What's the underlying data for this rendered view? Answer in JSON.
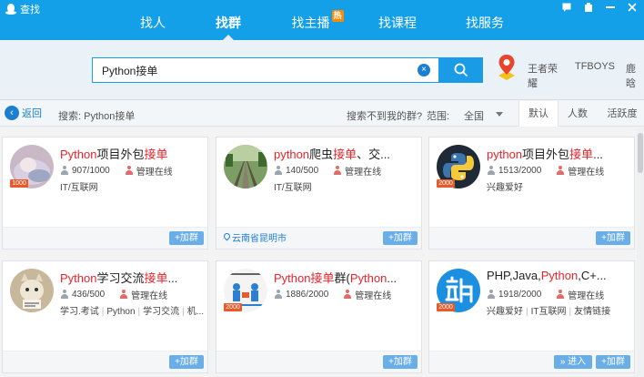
{
  "window": {
    "title": "查找",
    "controls": [
      "message-icon",
      "skin-icon",
      "minimize-icon",
      "close-icon"
    ]
  },
  "nav": {
    "tabs": [
      {
        "label": "找人",
        "active": false
      },
      {
        "label": "找群",
        "active": true
      },
      {
        "label": "找主播",
        "active": false,
        "badge": "热"
      },
      {
        "label": "找课程",
        "active": false
      },
      {
        "label": "找服务",
        "active": false
      }
    ]
  },
  "search": {
    "value": "Python接单",
    "clear_icon": "clear-icon",
    "button_icon": "search-icon",
    "hot_words": [
      "王者荣耀",
      "TFBOYS",
      "鹿晗"
    ]
  },
  "filter": {
    "back_label": "返回",
    "breadcrumb": "搜索: Python接单",
    "not_found": "搜索不到我的群?",
    "range_label": "范围:",
    "range_value": "全国",
    "sort_tabs": [
      {
        "label": "默认",
        "active": true
      },
      {
        "label": "人数",
        "active": false
      },
      {
        "label": "活跃度",
        "active": false
      }
    ]
  },
  "results": [
    {
      "title_parts": [
        {
          "t": "Python",
          "h": true
        },
        {
          "t": "项目外包",
          "h": false
        },
        {
          "t": "接单",
          "h": true
        }
      ],
      "members": "907/1000",
      "admin": "管理在线",
      "tags": [
        "IT/互联网"
      ],
      "badge": "1000",
      "location": "",
      "enter": "",
      "join": "+加群"
    },
    {
      "title_parts": [
        {
          "t": "python",
          "h": true
        },
        {
          "t": "爬虫",
          "h": false
        },
        {
          "t": "接单",
          "h": true
        },
        {
          "t": "、交...",
          "h": false
        }
      ],
      "members": "140/500",
      "admin": "管理在线",
      "tags": [
        "IT/互联网"
      ],
      "badge": "",
      "location": "云南省昆明市",
      "enter": "",
      "join": "+加群"
    },
    {
      "title_parts": [
        {
          "t": "python",
          "h": true
        },
        {
          "t": "项目外包",
          "h": false
        },
        {
          "t": "接单",
          "h": true
        },
        {
          "t": "...",
          "h": false
        }
      ],
      "members": "1513/2000",
      "admin": "管理在线",
      "tags": [
        "兴趣爱好"
      ],
      "badge": "2000",
      "location": "",
      "enter": "",
      "join": "+加群"
    },
    {
      "title_parts": [
        {
          "t": "Python",
          "h": true
        },
        {
          "t": "学习交流",
          "h": false
        },
        {
          "t": "接单",
          "h": true
        },
        {
          "t": "...",
          "h": false
        }
      ],
      "members": "436/500",
      "admin": "管理在线",
      "tags": [
        "学习.考试",
        "Python",
        "学习交流",
        "机..."
      ],
      "badge": "",
      "location": "",
      "enter": "",
      "join": "+加群"
    },
    {
      "title_parts": [
        {
          "t": "Python",
          "h": true
        },
        {
          "t": "接单",
          "h": true
        },
        {
          "t": "群(",
          "h": false
        },
        {
          "t": "Python",
          "h": true
        },
        {
          "t": "...",
          "h": false
        }
      ],
      "members": "1886/2000",
      "admin": "管理在线",
      "tags": [],
      "badge": "2000",
      "location": "",
      "enter": "",
      "join": "+加群"
    },
    {
      "title_parts": [
        {
          "t": "PHP,Java,",
          "h": false
        },
        {
          "t": "Python",
          "h": true
        },
        {
          "t": ",C+...",
          "h": false
        }
      ],
      "members": "1918/2000",
      "admin": "管理在线",
      "tags": [
        "兴趣爱好",
        "IT互联网",
        "友情链接"
      ],
      "badge": "2000",
      "location": "",
      "enter": "» 进入",
      "join": "+加群"
    }
  ]
}
